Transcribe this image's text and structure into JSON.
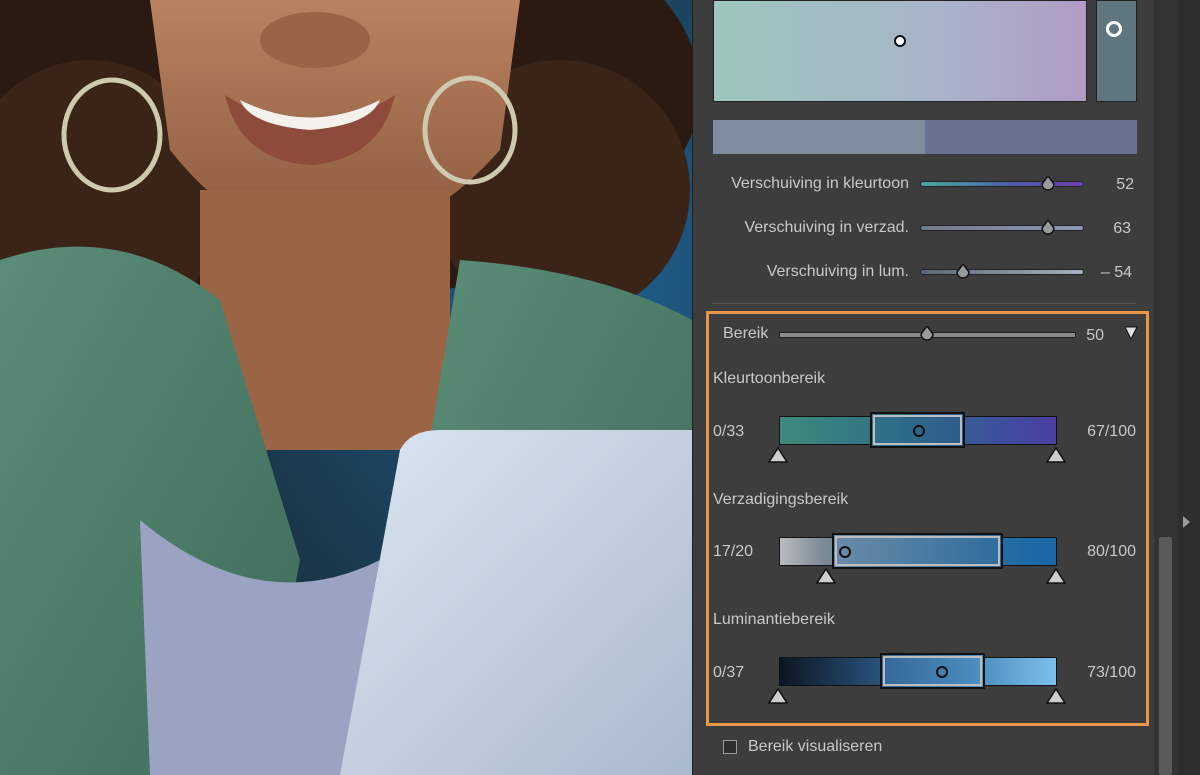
{
  "hue_adjust": {
    "sliders": [
      {
        "label": "Verschuiving in kleurtoon",
        "value": "52",
        "fraction": 0.78
      },
      {
        "label": "Verschuiving in verzad.",
        "value": "63",
        "fraction": 0.78
      },
      {
        "label": "Verschuiving in lum.",
        "value": "– 54",
        "fraction": 0.27
      }
    ]
  },
  "range": {
    "label": "Bereik",
    "value": "50",
    "fraction": 0.5,
    "hue": {
      "title": "Kleurtoonbereik",
      "left_label": "0/33",
      "right_label": "67/100"
    },
    "saturation": {
      "title": "Verzadigingsbereik",
      "left_label": "17/20",
      "right_label": "80/100"
    },
    "luminance": {
      "title": "Luminantiebereik",
      "left_label": "0/37",
      "right_label": "73/100"
    }
  },
  "visualize": {
    "label": "Bereik visualiseren",
    "checked": false
  },
  "colors": {
    "accent_highlight": "#e8964a",
    "panel": "#3d3d3d",
    "text": "#c8c8c8"
  }
}
